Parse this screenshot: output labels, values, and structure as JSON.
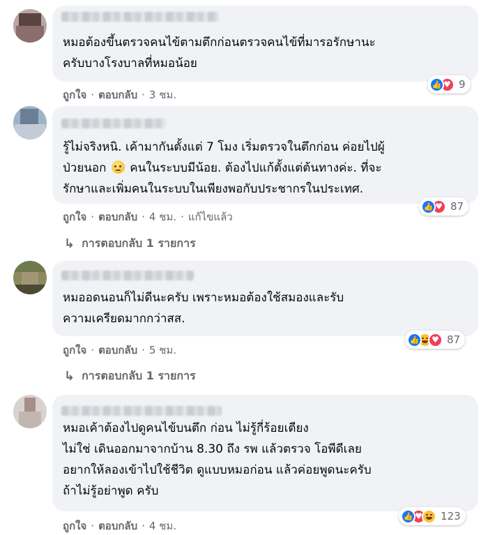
{
  "actions": {
    "like": "ถูกใจ",
    "reply": "ตอบกลับ",
    "separator": "·"
  },
  "comments": [
    {
      "lines": [
        "หมอต้องขึ้นตรวจคนไข้ตามตึกก่อนตรวจคนไข้ที่มารอรักษานะ",
        "ครับบางโรงบาลที่หมอน้อย"
      ],
      "time": "3 ชม.",
      "reaction_icons": [
        "like-icon",
        "love-icon"
      ],
      "reaction_count": "9"
    },
    {
      "lines": [
        "รู้ไม่จริงหนิ. เค้ามากันตั้งแต่ 7 โมง เริ่มตรวจในตึกก่อน ค่อยไปผู้",
        "ป่วยนอก",
        "คนในระบบมีน้อย. ต้องไปแก้ตั้งแต่ต้นทางค่ะ. ที่จะ",
        "รักษาและเพิ่มคนในระบบในเพียงพอกับประชากรในประเทศ."
      ],
      "time": "4 ชม.",
      "edited": "แก้ไขแล้ว",
      "reaction_icons": [
        "like-icon",
        "love-icon"
      ],
      "reaction_count": "87",
      "replies": "การตอบกลับ 1 รายการ"
    },
    {
      "lines": [
        "หมออดนอนก็ไม่ดีนะครับ เพราะหมอต้องใช้สมองและรับ",
        "ความเครียดมากกว่าสส."
      ],
      "time": "5 ชม.",
      "reaction_icons": [
        "like-icon",
        "haha-icon",
        "love-icon"
      ],
      "reaction_count": "87",
      "replies": "การตอบกลับ 1 รายการ"
    },
    {
      "lines": [
        "หมอเค้าต้องไปดูคนไข้บนตึก ก่อน ไม่รู้กี่ร้อยเตียง",
        "ไม่ใช่ เดินออกมาจากบ้าน 8.30 ถึง รพ แล้วตรวจ โอพีดีเลย",
        "อยากให้ลองเข้าไปใช้ชีวิต ดูแบบหมอก่อน แล้วค่อยพูดนะครับ",
        "ถ้าไม่รู้อย่าพูด ครับ"
      ],
      "time": "4 ชม.",
      "reaction_icons": [
        "like-icon",
        "love-icon",
        "haha-icon"
      ],
      "reaction_count": "123"
    }
  ],
  "colors": {
    "bubble": "#f0f2f5",
    "meta": "#65676b",
    "like": "#1877f2",
    "love": "#f33e58",
    "haha": "#f7c33b"
  }
}
